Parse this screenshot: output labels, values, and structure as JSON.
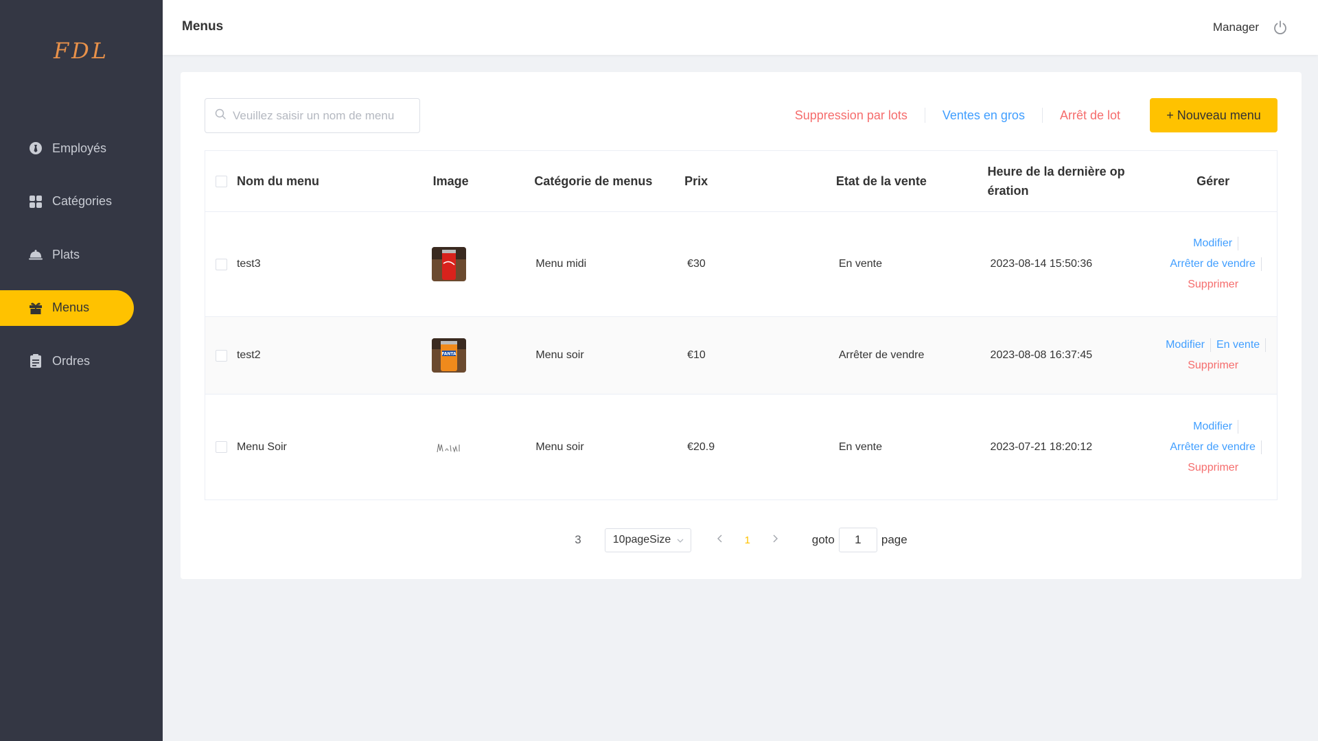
{
  "sidebar": {
    "logo": "FDL",
    "items": [
      {
        "label": "Employés",
        "icon": "employee-icon",
        "active": false
      },
      {
        "label": "Catégories",
        "icon": "grid-icon",
        "active": false
      },
      {
        "label": "Plats",
        "icon": "cloche-icon",
        "active": false
      },
      {
        "label": "Menus",
        "icon": "gift-icon",
        "active": true
      },
      {
        "label": "Ordres",
        "icon": "clipboard-icon",
        "active": false
      }
    ]
  },
  "header": {
    "title": "Menus",
    "user": "Manager",
    "logout_icon": "power-icon"
  },
  "toolbar": {
    "search_placeholder": "Veuillez saisir un nom de menu",
    "search_value": "",
    "batch_delete": "Suppression par lots",
    "bulk_sale": "Ventes en gros",
    "batch_stop": "Arrêt de lot",
    "new_menu": "+ Nouveau menu"
  },
  "table": {
    "columns": {
      "name": "Nom du menu",
      "image": "Image",
      "category": "Catégorie de menus",
      "price": "Prix",
      "state": "Etat de la vente",
      "time": "Heure de la dernière op ération",
      "manage": "Gérer"
    },
    "rows": [
      {
        "name": "test3",
        "image": "cola-can",
        "category": "Menu midi",
        "price": "€30",
        "state": "En vente",
        "time": "2023-08-14 15:50:36",
        "ops": {
          "modify": "Modifier",
          "toggle": "Arrêter de vendre",
          "delete": "Supprimer"
        }
      },
      {
        "name": "test2",
        "image": "fanta-can",
        "category": "Menu soir",
        "price": "€10",
        "state": "Arrêter de vendre",
        "time": "2023-08-08 16:37:45",
        "ops": {
          "modify": "Modifier",
          "toggle": "En vente",
          "delete": "Supprimer"
        }
      },
      {
        "name": "Menu Soir",
        "image": "handwriting",
        "category": "Menu soir",
        "price": "€20.9",
        "state": "En vente",
        "time": "2023-07-21 18:20:12",
        "ops": {
          "modify": "Modifier",
          "toggle": "Arrêter de vendre",
          "delete": "Supprimer"
        }
      }
    ]
  },
  "pagination": {
    "total": "3",
    "page_size": "10pageSize",
    "current_page": "1",
    "goto_label": "goto",
    "goto_value": "1",
    "page_label": "page"
  },
  "colors": {
    "sidebar_bg": "#343744",
    "accent": "#ffc200",
    "link_blue": "#409eff",
    "link_red": "#f56c6c"
  }
}
